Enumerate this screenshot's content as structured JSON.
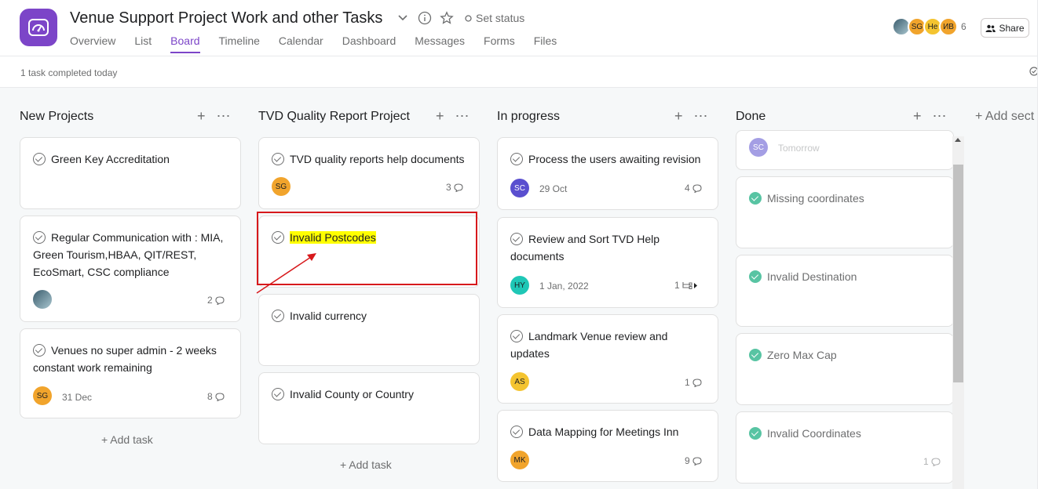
{
  "header": {
    "title": "Venue Support Project Work and other Tasks",
    "set_status": "Set status",
    "tabs": [
      "Overview",
      "List",
      "Board",
      "Timeline",
      "Calendar",
      "Dashboard",
      "Messages",
      "Forms",
      "Files"
    ],
    "active_tab": "Board",
    "members": [
      {
        "initials": "",
        "color": "#6a8fa0"
      },
      {
        "initials": "SG",
        "color": "#f1a42c"
      },
      {
        "initials": "He",
        "color": "#f4c430"
      },
      {
        "initials": "ИВ",
        "color": "#f1a42c"
      }
    ],
    "member_count": "6",
    "share_label": "Share"
  },
  "subbar": {
    "status_text": "1 task completed today"
  },
  "board": {
    "add_section_label": "+ Add sect",
    "columns": [
      {
        "name": "New Projects",
        "add_task": "+ Add task",
        "cards": [
          {
            "title": "Green Key Accreditation"
          },
          {
            "title_lines": [
              "Regular Communication with : MIA,",
              "Green Tourism,HBAA, QIT/REST,",
              "EcoSmart, CSC compliance"
            ],
            "count": "2"
          },
          {
            "title_lines": [
              "Venues no super admin - 2 weeks",
              "constant work remaining"
            ],
            "assignee": "SG",
            "due": "31 Dec",
            "count": "8"
          }
        ]
      },
      {
        "name": "TVD Quality Report Project",
        "add_task": "+ Add task",
        "cards": [
          {
            "title": "TVD quality reports help documents",
            "assignee": "SG",
            "count": "3"
          },
          {
            "title": "Invalid Postcodes"
          },
          {
            "title": "Invalid currency"
          },
          {
            "title": "Invalid County or Country"
          }
        ]
      },
      {
        "name": "In progress",
        "cards": [
          {
            "title": "Process the users awaiting revision",
            "assignee": "SC",
            "due": "29 Oct",
            "count": "4"
          },
          {
            "title_lines": [
              "Review and Sort TVD Help",
              "documents"
            ],
            "assignee": "HY",
            "due": "1 Jan, 2022",
            "count": "1"
          },
          {
            "title_lines": [
              "Landmark Venue review and",
              "updates"
            ],
            "assignee": "AS",
            "count": "1"
          },
          {
            "title": "Data Mapping for Meetings Inn",
            "assignee": "MK",
            "count": "9"
          }
        ]
      },
      {
        "name": "Done",
        "cards": [
          {
            "assignee": "SC",
            "due": "Tomorrow"
          },
          {
            "title": "Missing coordinates"
          },
          {
            "title": "Invalid Destination"
          },
          {
            "title": "Zero Max Cap"
          },
          {
            "title": "Invalid Coordinates",
            "count": "1"
          }
        ]
      }
    ]
  },
  "colors": {
    "brand": "#7c45c8",
    "highlight": "#ffff00",
    "annotation": "#d7191c",
    "done_check": "#58c4a3"
  }
}
